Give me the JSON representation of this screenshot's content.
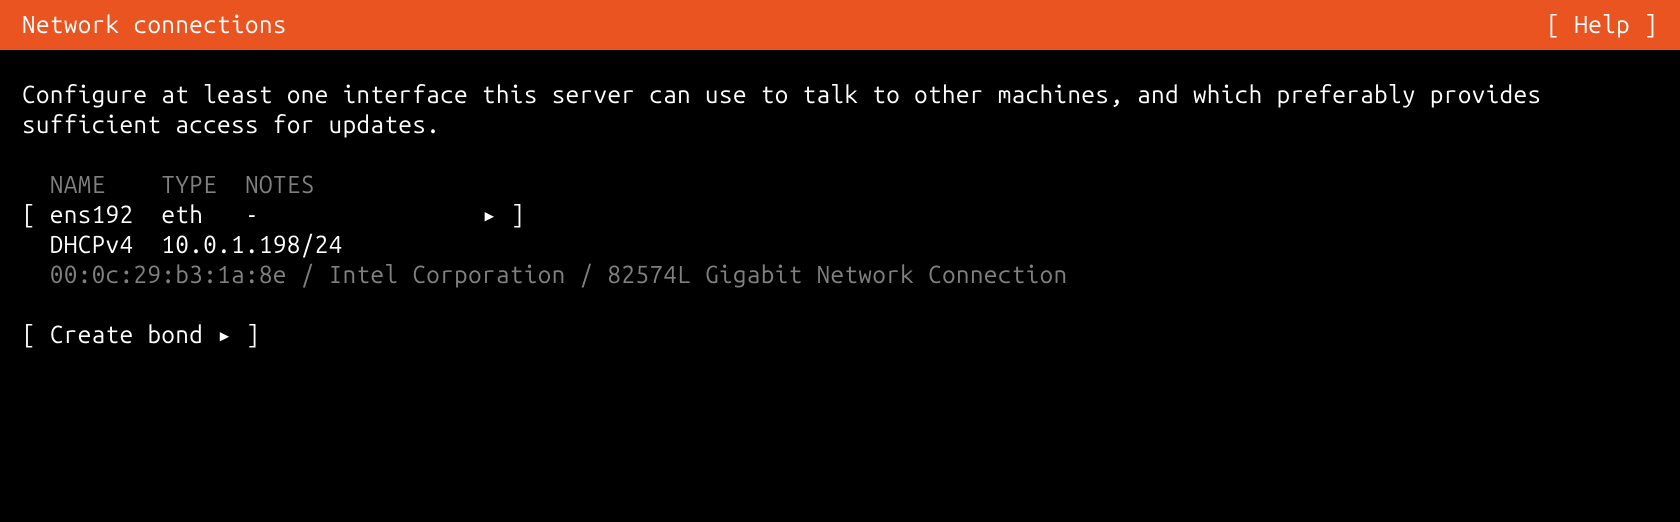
{
  "header": {
    "title": "Network connections",
    "help_label": "Help"
  },
  "instruction": "Configure at least one interface this server can use to talk to other machines, and which preferably provides sufficient access for updates.",
  "table": {
    "headers": {
      "name": "NAME",
      "type": "TYPE",
      "notes": "NOTES"
    }
  },
  "interfaces": [
    {
      "name": "ens192",
      "type": "eth",
      "notes": "-",
      "triangle": "▸",
      "dhcp_label": "DHCPv4",
      "address": "10.0.1.198/24",
      "mac": "00:0c:29:b3:1a:8e",
      "vendor": "Intel Corporation",
      "model": "82574L Gigabit Network Connection"
    }
  ],
  "actions": {
    "create_bond_label": "Create bond",
    "triangle": "▸"
  },
  "brackets": {
    "open": "[",
    "close": "]"
  }
}
